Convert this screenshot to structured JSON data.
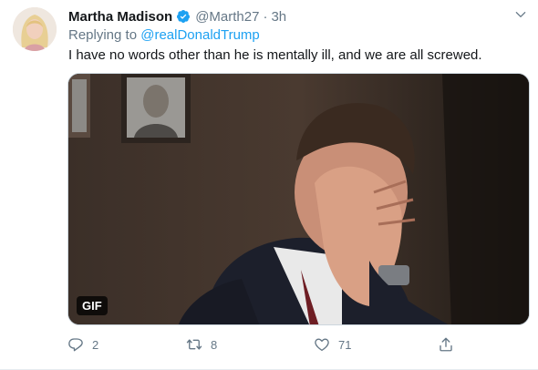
{
  "tweet": {
    "author_name": "Martha Madison",
    "handle": "@Marth27",
    "separator": "·",
    "time": "3h",
    "replying_prefix": "Replying to ",
    "replying_to": "@realDonaldTrump",
    "text": "I have no words other than he is mentally ill, and we are all screwed.",
    "media_badge": "GIF",
    "icons": {
      "verified": "verified-badge-icon",
      "menu": "chevron-down-icon",
      "reply": "reply-icon",
      "retweet": "retweet-icon",
      "like": "heart-icon",
      "share": "share-icon"
    },
    "colors": {
      "accent": "#1da1f2",
      "muted": "#657786",
      "text": "#14171a"
    }
  },
  "actions": {
    "reply_count": "2",
    "retweet_count": "8",
    "like_count": "71"
  }
}
